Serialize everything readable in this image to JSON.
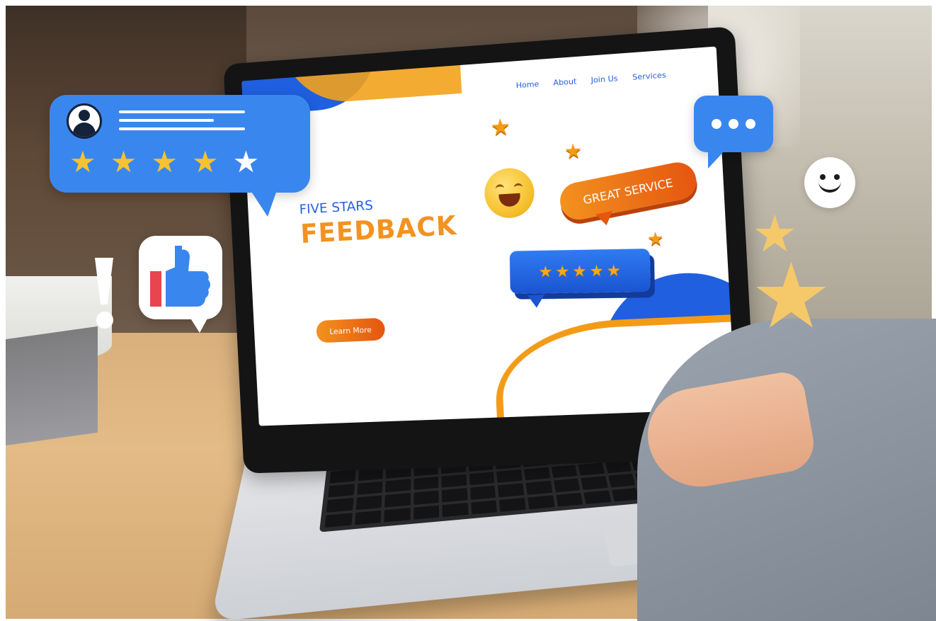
{
  "screen": {
    "nav": [
      "Home",
      "About",
      "Join Us",
      "Services"
    ],
    "headline_small": "FIVE STARS",
    "headline_big": "FEEDBACK",
    "cta_label": "Learn More",
    "badge_label": "GREAT SERVICE",
    "rating": {
      "stars_filled": 5,
      "stars_total": 5
    }
  },
  "review_card": {
    "stars_filled": 4,
    "stars_total": 5
  },
  "icons": {
    "avatar": "user-avatar-icon",
    "thumbs_up": "thumbs-up-icon",
    "exclamation": "exclamation-icon",
    "typing": "ellipsis-chat-icon",
    "smiley": "smiley-face-icon",
    "emoji": "laughing-emoji-icon"
  },
  "colors": {
    "brand_blue": "#1f5fe0",
    "bubble_blue": "#3a86ef",
    "brand_orange": "#f3921f",
    "star_gold": "#f6c231",
    "deco_star": "#f5c86a"
  }
}
